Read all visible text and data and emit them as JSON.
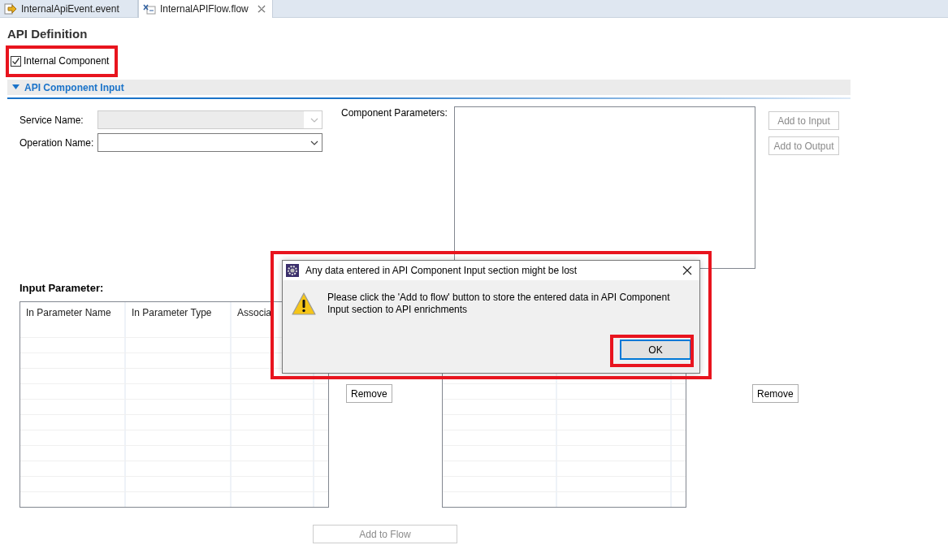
{
  "tabs": [
    {
      "label": "InternalApiEvent.event",
      "selected": false,
      "closable": false
    },
    {
      "label": "InternalAPIFlow.flow",
      "selected": true,
      "closable": true
    }
  ],
  "page_title": "API Definition",
  "internal_component": {
    "label": "Internal Component",
    "checked": true,
    "highlighted": true
  },
  "section": {
    "title": "API Component Input",
    "expanded": true
  },
  "fields": [
    {
      "label": "Service Name:",
      "disabled": true
    },
    {
      "label": "Operation Name:",
      "disabled": false
    }
  ],
  "component_parameters": {
    "label": "Component Parameters:"
  },
  "side_buttons": [
    {
      "label": "Add to Input",
      "disabled": true
    },
    {
      "label": "Add to Output",
      "disabled": true
    }
  ],
  "input_parameter": {
    "title": "Input Parameter:",
    "columns": [
      "In Parameter Name",
      "In Parameter Type",
      "Associa"
    ],
    "remove_button": "Remove"
  },
  "output_table": {
    "remove_button": "Remove"
  },
  "add_to_flow": {
    "label": "Add to Flow",
    "disabled": true
  },
  "dialog": {
    "title": "Any data entered in API Component Input section might be lost",
    "message": "Please click the 'Add to flow' button to store the entered data in API Component Input section to API enrichments",
    "button": "OK",
    "highlighted": true,
    "button_highlighted": true
  }
}
